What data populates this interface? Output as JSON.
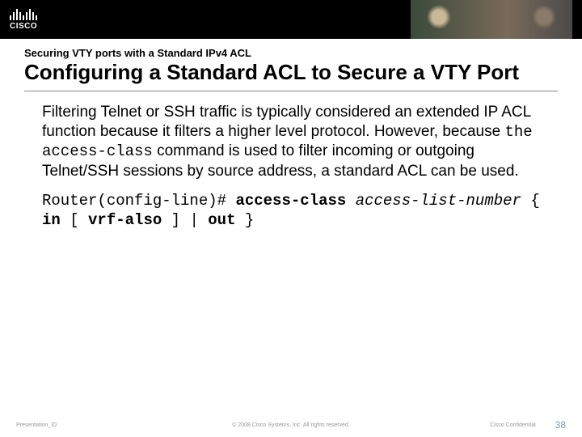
{
  "header": {
    "logo_text": "CISCO"
  },
  "title": {
    "subtitle": "Securing VTY ports with a Standard IPv4 ACL",
    "main": "Configuring a Standard ACL to Secure a VTY Port"
  },
  "body": {
    "p1a": "Filtering Telnet or SSH traffic is typically considered an extended IP ACL function because it filters a higher level protocol. However, because ",
    "p1_mono": "the access-class",
    "p1b": " command is used to filter incoming or outgoing Telnet/SSH sessions by source address, a standard ACL can be used."
  },
  "cmd": {
    "prompt": "Router(config-line)# ",
    "kw1": "access-class ",
    "arg1": "access-list-number",
    "brace_open": " { ",
    "kw2": "in",
    "opt_open": " [ ",
    "kw3": "vrf-also",
    "opt_close": " ] ",
    "pipe": "| ",
    "kw4": "out",
    "brace_close": " }"
  },
  "footer": {
    "left": "Presentation_ID",
    "center": "© 2008 Cisco Systems, Inc. All rights reserved.",
    "confidential": "Cisco Confidential",
    "page": "38"
  }
}
